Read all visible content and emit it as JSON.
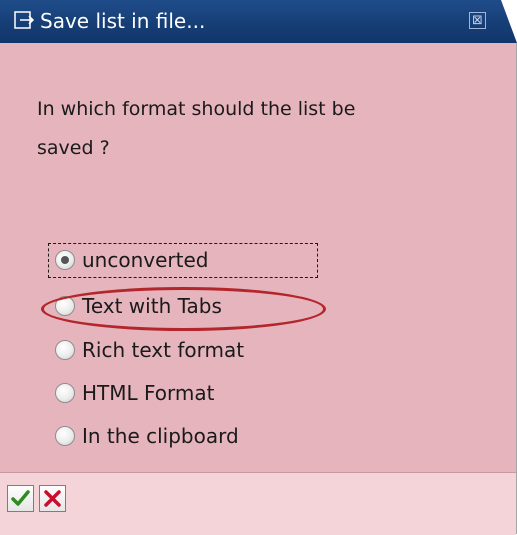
{
  "dialog": {
    "title": "Save list in file...",
    "question": "In which format should the list be saved ?",
    "close_symbol": "⊠"
  },
  "options": [
    {
      "label": "unconverted",
      "checked": true
    },
    {
      "label": "Text with Tabs",
      "checked": false
    },
    {
      "label": "Rich text format",
      "checked": false
    },
    {
      "label": "HTML Format",
      "checked": false
    },
    {
      "label": "In the clipboard",
      "checked": false
    }
  ],
  "footer": {
    "confirm_icon": "checkmark-icon",
    "cancel_icon": "cross-icon"
  },
  "colors": {
    "titlebar": "#163e76",
    "dialog_bg": "#e6b4bc",
    "footer_bg": "#f4d4d8",
    "highlight": "#b3272c",
    "confirm": "#2e8b1e",
    "cancel": "#c8102e"
  }
}
